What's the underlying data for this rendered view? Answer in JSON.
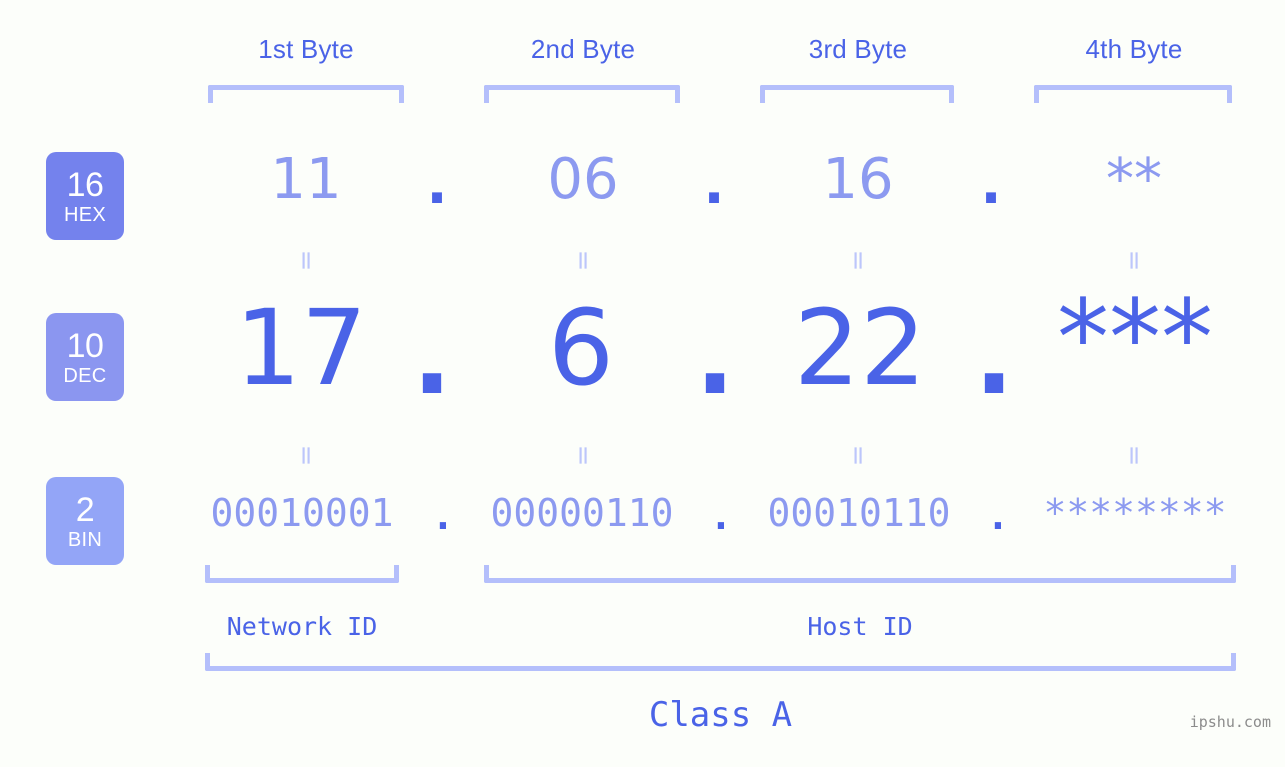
{
  "background_color": "#fcfefa",
  "accent_color": "#4a63e7",
  "accent_light_color": "#8c9af0",
  "bracket_color": "#b4bffb",
  "byte_headers": [
    {
      "label": "1st Byte"
    },
    {
      "label": "2nd Byte"
    },
    {
      "label": "3rd Byte"
    },
    {
      "label": "4th Byte"
    }
  ],
  "rows": [
    {
      "badge_number": "16",
      "badge_name": "HEX",
      "badge_color": "#7482ed",
      "values": [
        "11",
        "06",
        "16",
        "**"
      ],
      "separators": [
        ".",
        ".",
        "."
      ]
    },
    {
      "badge_number": "10",
      "badge_name": "DEC",
      "badge_color": "#8b96f0",
      "values": [
        "17",
        "6",
        "22",
        "***"
      ],
      "separators": [
        ".",
        ".",
        "."
      ]
    },
    {
      "badge_number": "2",
      "badge_name": "BIN",
      "badge_color": "#93a5f7",
      "values": [
        "00010001",
        "00000110",
        "00010110",
        "********"
      ],
      "separators": [
        ".",
        ".",
        "."
      ]
    }
  ],
  "equals_separator": "=",
  "sections": [
    {
      "label": "Network ID"
    },
    {
      "label": "Host ID"
    }
  ],
  "class_label": "Class A",
  "watermark": "ipshu.com"
}
